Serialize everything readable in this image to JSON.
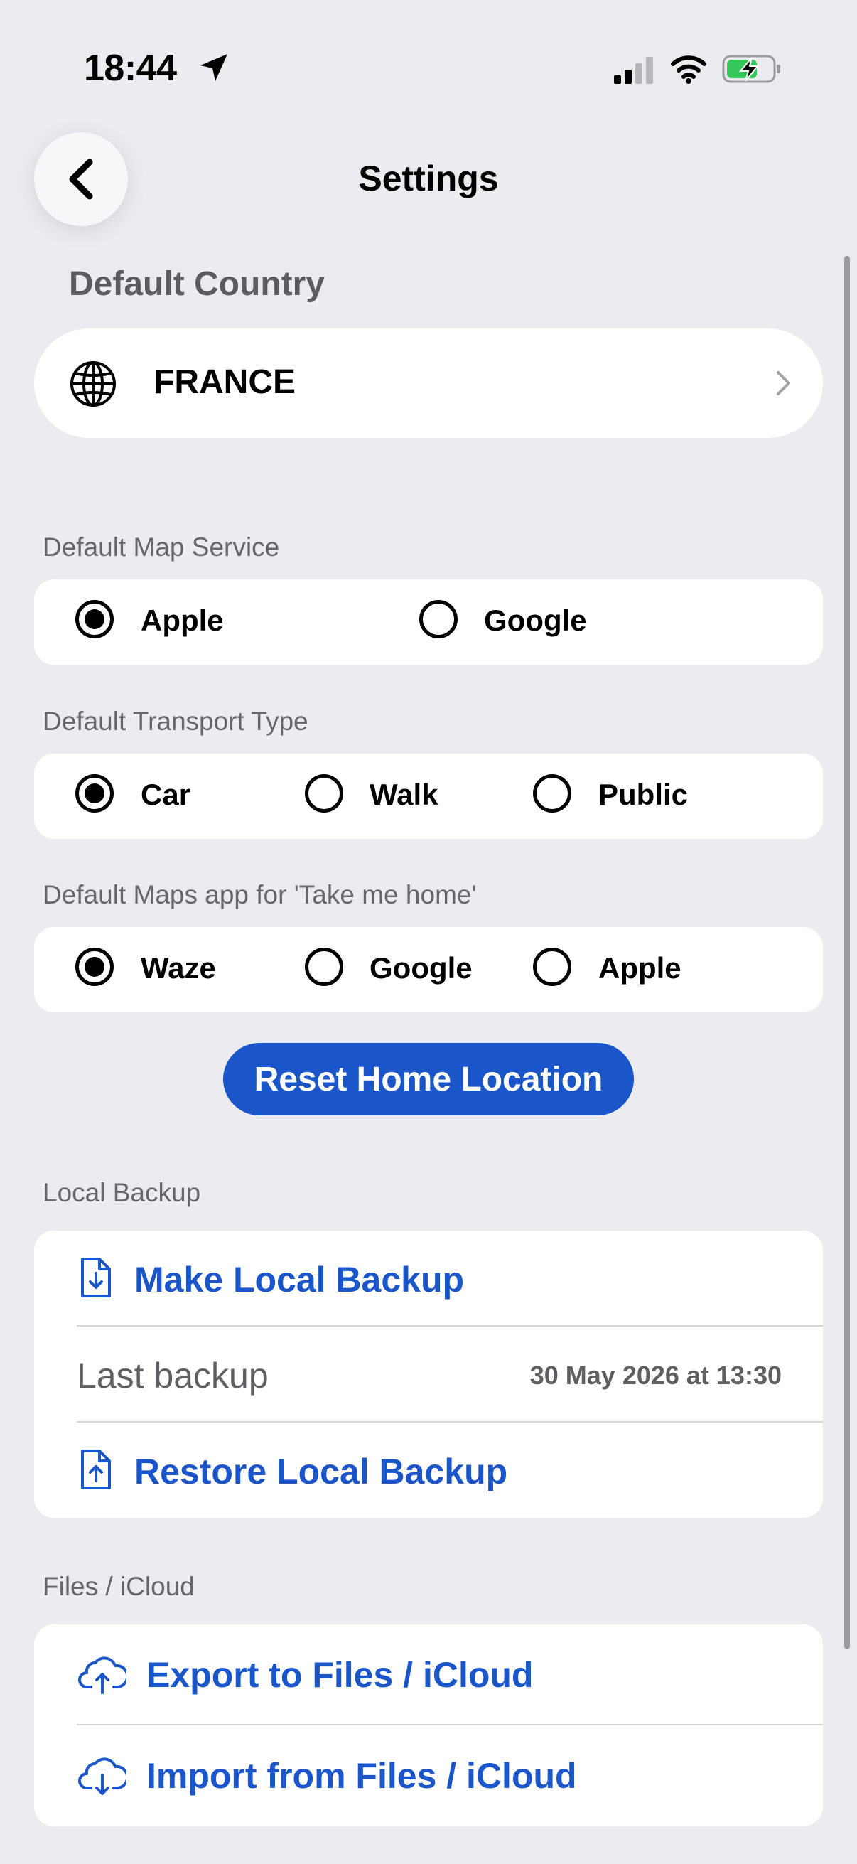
{
  "status_bar": {
    "time": "18:44"
  },
  "header": {
    "title": "Settings"
  },
  "default_country": {
    "title": "Default Country",
    "value": "FRANCE"
  },
  "map_service": {
    "label": "Default Map Service",
    "options": [
      {
        "label": "Apple",
        "selected": true
      },
      {
        "label": "Google",
        "selected": false
      }
    ]
  },
  "transport": {
    "label": "Default Transport Type",
    "options": [
      {
        "label": "Car",
        "selected": true
      },
      {
        "label": "Walk",
        "selected": false
      },
      {
        "label": "Public",
        "selected": false
      }
    ]
  },
  "home_app": {
    "label": "Default Maps app for 'Take me home'",
    "options": [
      {
        "label": "Waze",
        "selected": true
      },
      {
        "label": "Google",
        "selected": false
      },
      {
        "label": "Apple",
        "selected": false
      }
    ]
  },
  "reset_button": "Reset Home Location",
  "local_backup": {
    "label": "Local Backup",
    "make": "Make Local Backup",
    "last_label": "Last backup",
    "last_value": "30 May 2026 at 13:30",
    "restore": "Restore Local Backup"
  },
  "icloud": {
    "label": "Files / iCloud",
    "export": "Export to Files / iCloud",
    "import": "Import from Files / iCloud"
  },
  "colors": {
    "accent": "#1a56c9",
    "background": "#ebebf0",
    "card": "#ffffff",
    "battery": "#34c759"
  }
}
